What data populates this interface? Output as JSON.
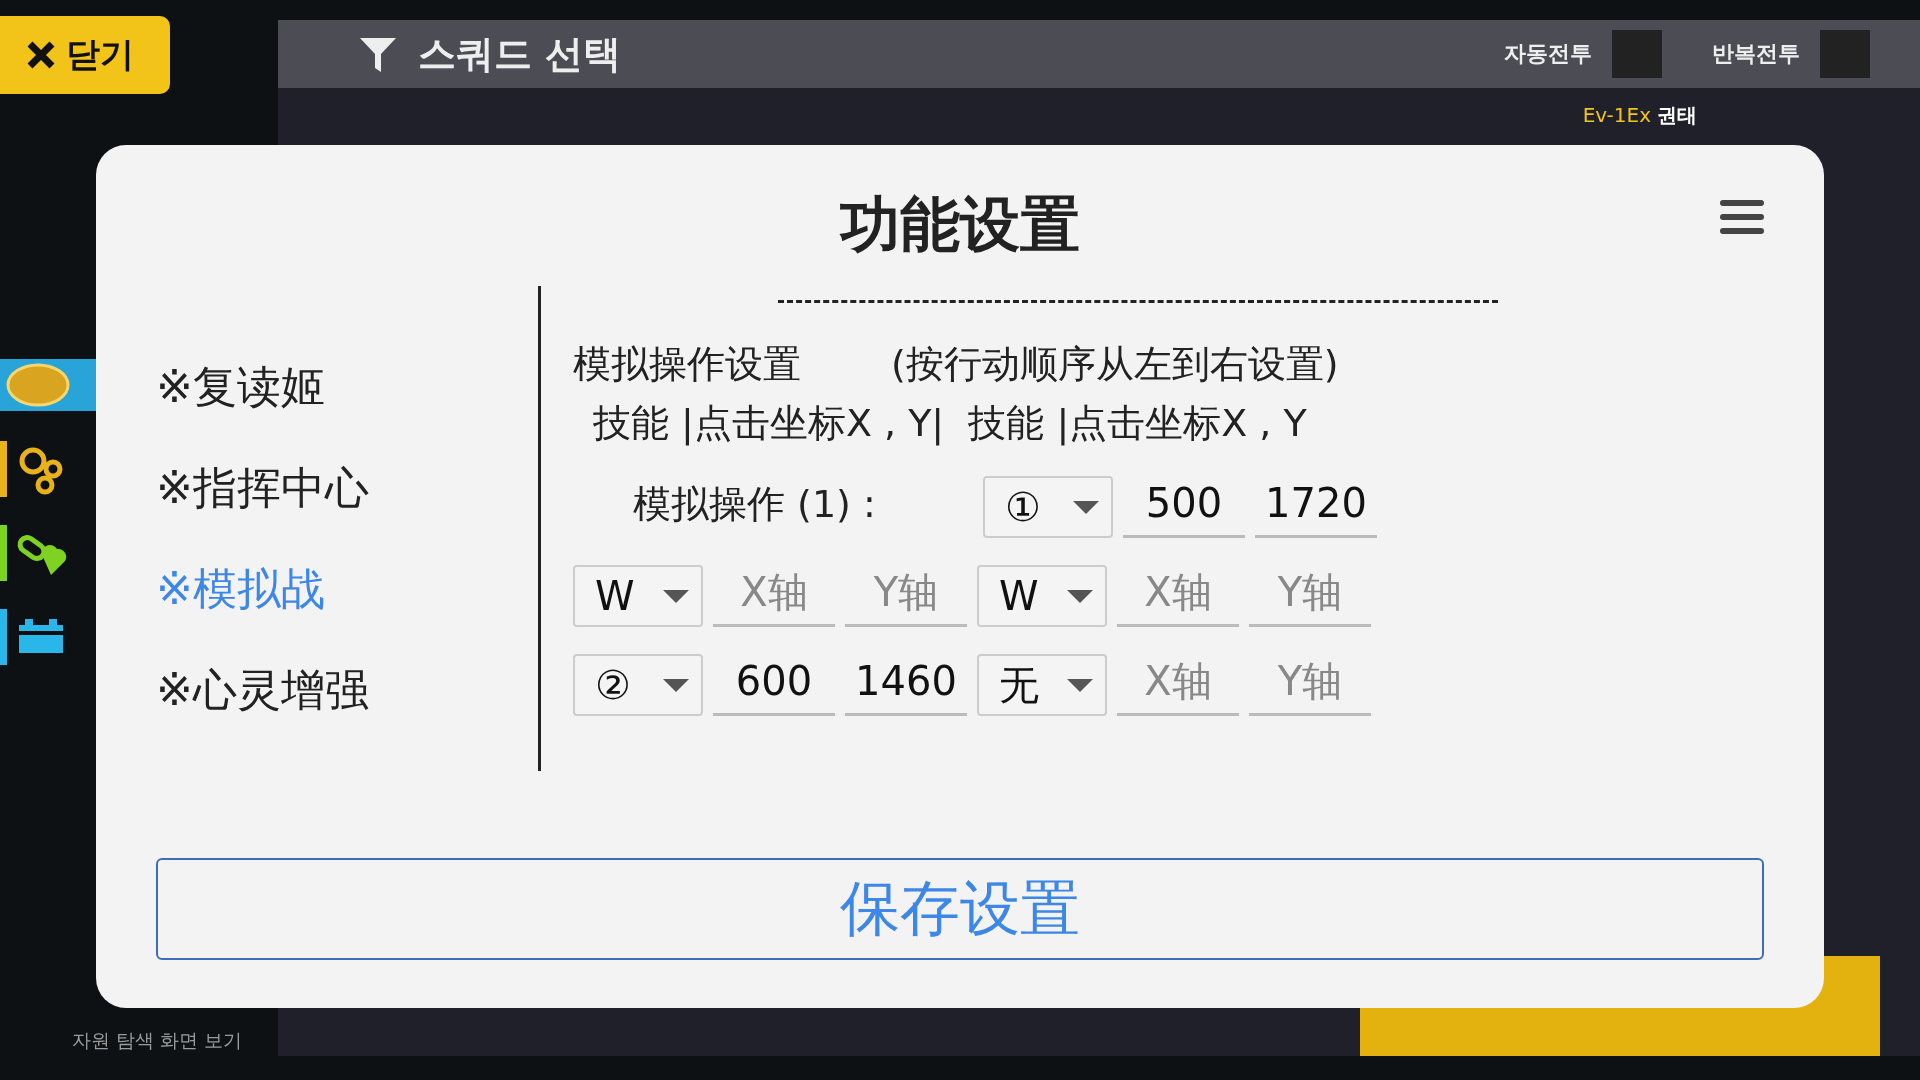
{
  "close_button": {
    "label": "닫기"
  },
  "top_bar": {
    "title": "스쿼드 선택",
    "toggles": [
      {
        "label": "자동전투"
      },
      {
        "label": "반복전투"
      }
    ]
  },
  "resources": [
    {
      "color": "#e8b21a"
    },
    {
      "color": "#7ed321"
    },
    {
      "color": "#29b6e8"
    }
  ],
  "footer_link": "자원 탐색 화면 보기",
  "stage": {
    "code": "Ev-1Ex",
    "name": "권태"
  },
  "dialog": {
    "title": "功能设置",
    "menu": [
      {
        "label": "※复读姬",
        "selected": false
      },
      {
        "label": "※指挥中心",
        "selected": false
      },
      {
        "label": "※模拟战",
        "selected": true
      },
      {
        "label": "※心灵增强",
        "selected": false
      }
    ],
    "heading": "模拟操作设置",
    "hint": "(按行动顺序从左到右设置)",
    "columns_header": "技能 |点击坐标X , Y|  技能 |点击坐标X , Y",
    "first_action": {
      "label": "模拟操作 (1) :",
      "cells": [
        {
          "kind": "select",
          "value": "①"
        },
        {
          "kind": "input",
          "value": "500"
        },
        {
          "kind": "input",
          "value": "1720"
        }
      ]
    },
    "rows": [
      {
        "cells": [
          {
            "kind": "select",
            "value": "W"
          },
          {
            "kind": "input",
            "placeholder": "X轴"
          },
          {
            "kind": "input",
            "placeholder": "Y轴"
          },
          {
            "kind": "select",
            "value": "W"
          },
          {
            "kind": "input",
            "placeholder": "X轴"
          },
          {
            "kind": "input",
            "placeholder": "Y轴"
          }
        ]
      },
      {
        "cells": [
          {
            "kind": "select",
            "value": "②"
          },
          {
            "kind": "input",
            "value": "600"
          },
          {
            "kind": "input",
            "value": "1460"
          },
          {
            "kind": "select",
            "value": "无"
          },
          {
            "kind": "input",
            "placeholder": "X轴"
          },
          {
            "kind": "input",
            "placeholder": "Y轴"
          }
        ]
      }
    ],
    "save_button": "保存设置"
  }
}
